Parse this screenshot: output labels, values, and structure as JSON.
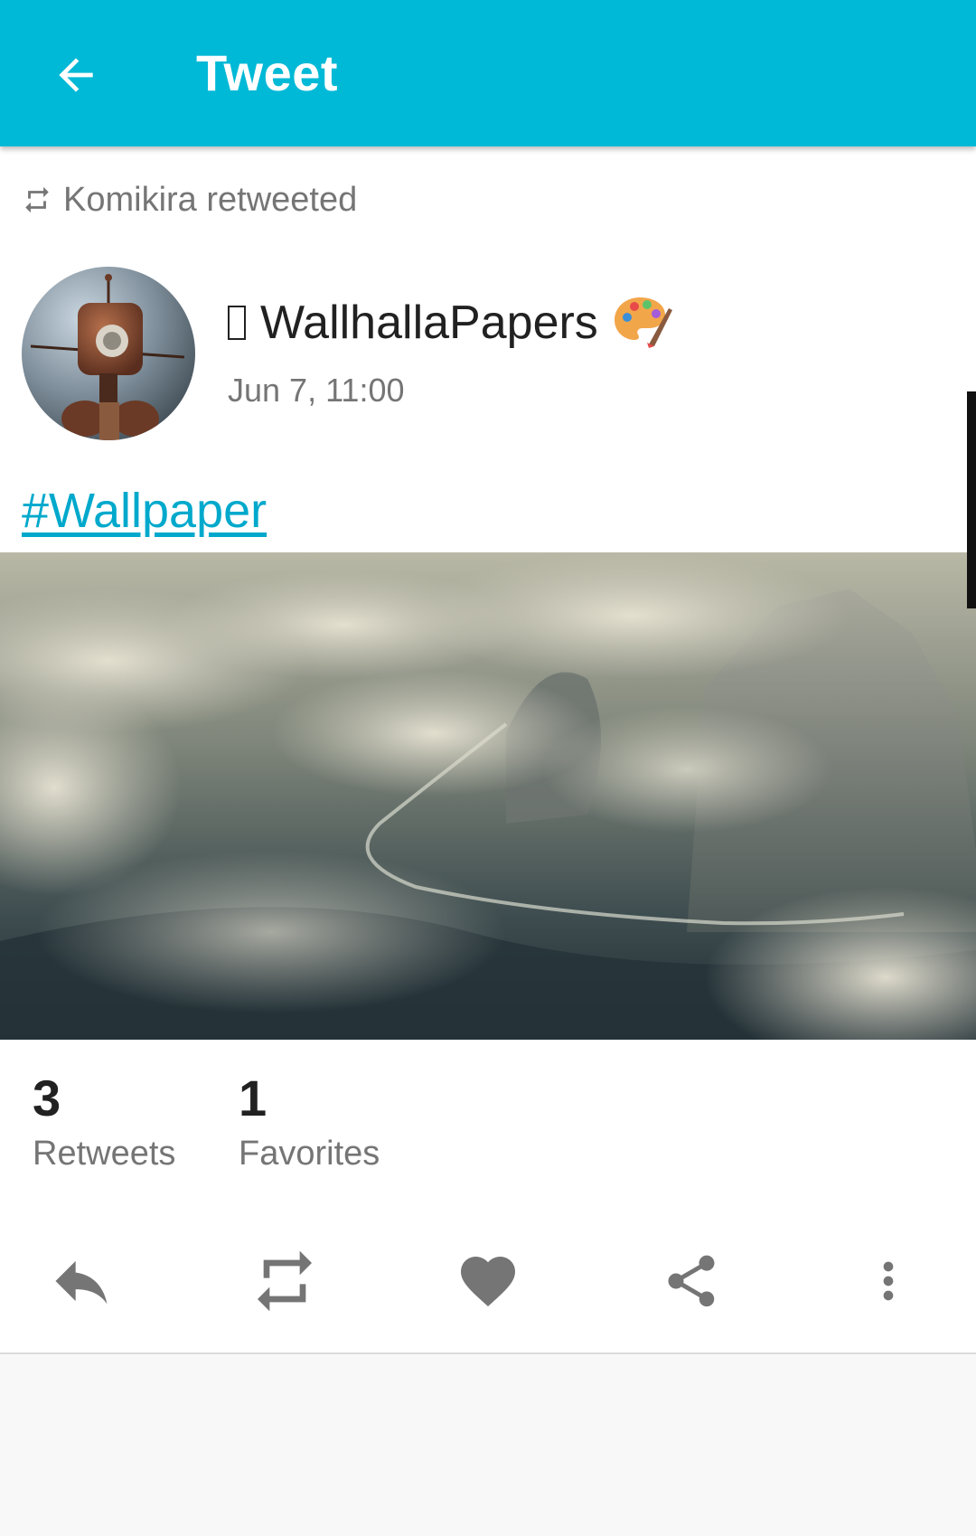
{
  "appbar": {
    "title": "Tweet",
    "back_icon": "arrow-left-icon",
    "color": "#00b9d6"
  },
  "tweet": {
    "retweeted_by": "Komikira retweeted",
    "retweet_icon": "retweet-small-icon",
    "author": {
      "display_name": "WallhallaPapers",
      "name_emoji": "🎨",
      "avatar": "robot-avatar"
    },
    "timestamp": "Jun 7, 11:00",
    "text": "#Wallpaper",
    "media": "wallpaper-image-clouds-valley",
    "stats": {
      "retweets_count": "3",
      "retweets_label": "Retweets",
      "favorites_count": "1",
      "favorites_label": "Favorites"
    },
    "actions": [
      {
        "icon": "reply-icon"
      },
      {
        "icon": "retweet-icon"
      },
      {
        "icon": "heart-icon"
      },
      {
        "icon": "share-icon"
      },
      {
        "icon": "more-vert-icon"
      }
    ]
  },
  "colors": {
    "accent": "#00b9d6",
    "link": "#00a9cc",
    "icon": "#757575"
  }
}
